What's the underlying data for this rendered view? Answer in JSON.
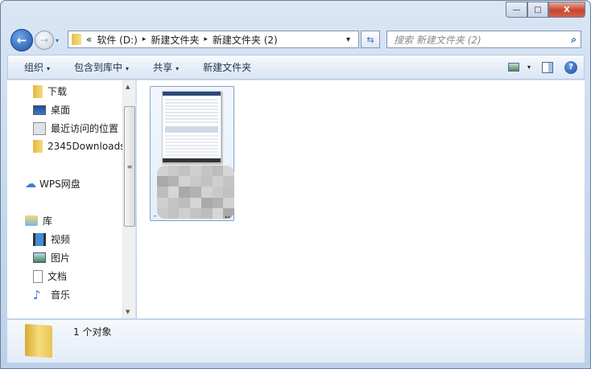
{
  "window": {
    "minimize_label": "—",
    "maximize_label": "□",
    "close_label": "X"
  },
  "address": {
    "overflow": "«",
    "crumbs": [
      "软件 (D:)",
      "新建文件夹",
      "新建文件夹 (2)"
    ],
    "separator": "▸",
    "dropdown": "▾"
  },
  "search": {
    "placeholder": "搜索 新建文件夹 (2)",
    "icon": "⌕"
  },
  "toolbar": {
    "organize": "组织",
    "include_library": "包含到库中",
    "share": "共享",
    "new_folder": "新建文件夹",
    "arrow": "▾",
    "help": "?"
  },
  "nav_pane": {
    "items": [
      {
        "label": "下载",
        "icon": "download-folder-icon"
      },
      {
        "label": "桌面",
        "icon": "desktop-icon"
      },
      {
        "label": "最近访问的位置",
        "icon": "recent-places-icon"
      },
      {
        "label": "2345Downloads",
        "icon": "folder-icon"
      },
      {
        "label": "WPS网盘",
        "icon": "cloud-icon"
      },
      {
        "label": "库",
        "icon": "library-icon"
      },
      {
        "label": "视频",
        "icon": "video-icon"
      },
      {
        "label": "图片",
        "icon": "pictures-icon"
      },
      {
        "label": "文档",
        "icon": "documents-icon"
      },
      {
        "label": "音乐",
        "icon": "music-icon"
      }
    ]
  },
  "content": {
    "file_ellipsis": "..",
    "file_prefix": "-"
  },
  "details": {
    "count_text": "1 个对象"
  }
}
